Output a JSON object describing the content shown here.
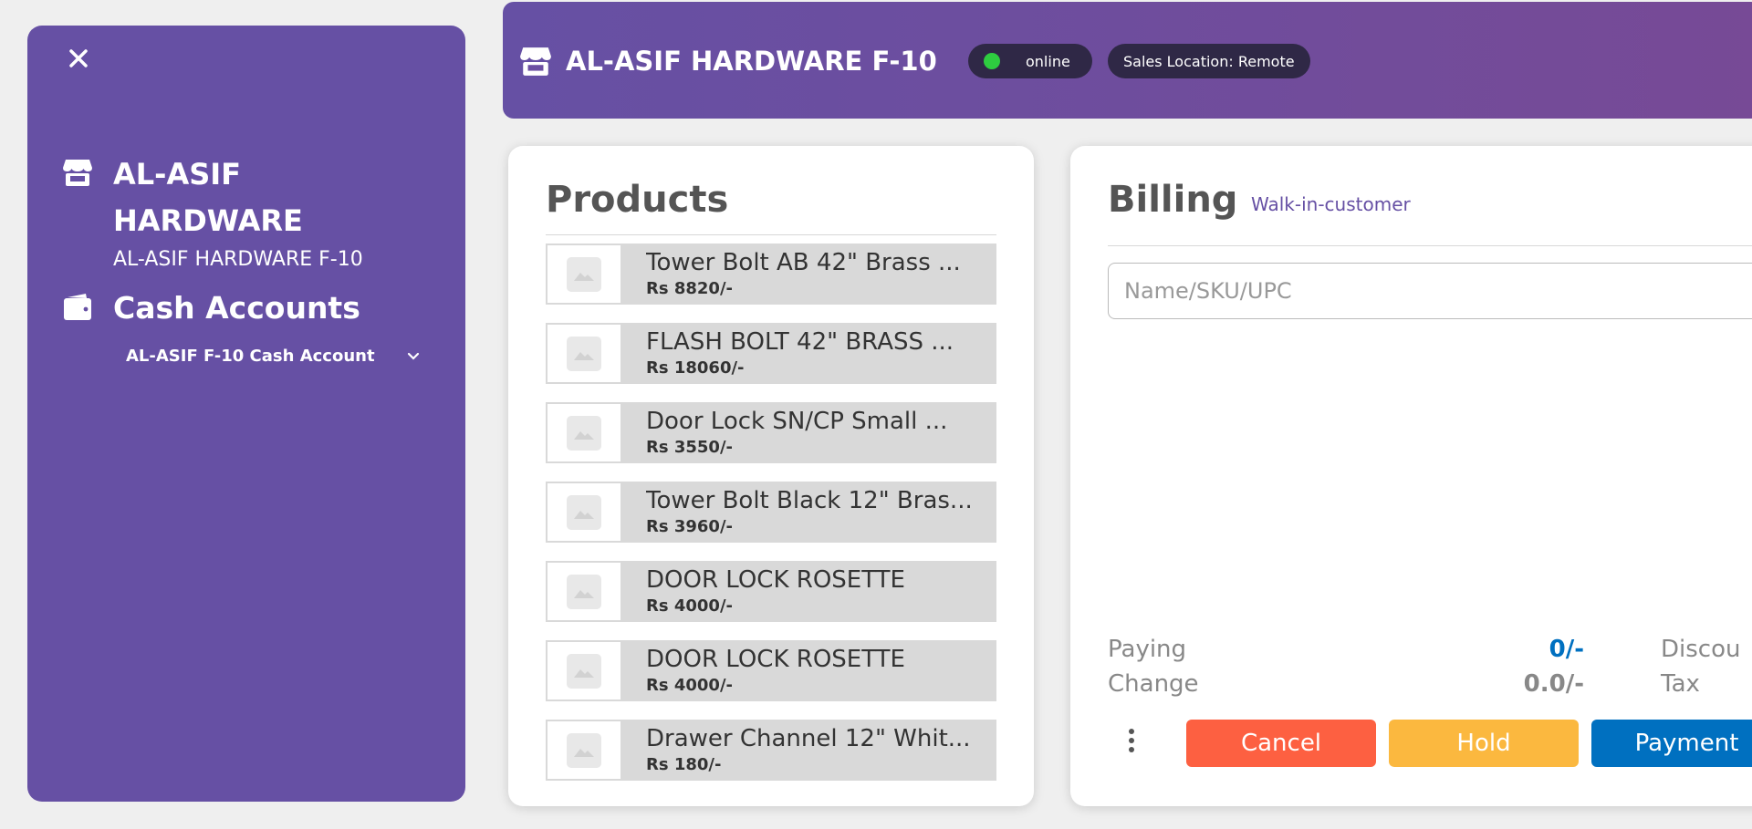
{
  "sidebar": {
    "store_name": "AL-ASIF HARDWARE",
    "store_subtitle": "AL-ASIF HARDWARE F-10",
    "cash_title": "Cash Accounts",
    "cash_account_selected": "AL-ASIF F-10 Cash Account"
  },
  "header": {
    "title": "AL-ASIF HARDWARE F-10",
    "status": "online",
    "status_color": "#2ecc40",
    "location": "Sales Location: Remote"
  },
  "products": {
    "title": "Products",
    "items": [
      {
        "name": "Tower Bolt AB 42\" Brass ...",
        "price": "Rs 8820/-"
      },
      {
        "name": "FLASH BOLT 42\" BRASS ...",
        "price": "Rs 18060/-"
      },
      {
        "name": "Door Lock SN/CP Small ...",
        "price": "Rs 3550/-"
      },
      {
        "name": "Tower Bolt Black 12\" Bras...",
        "price": "Rs 3960/-"
      },
      {
        "name": "DOOR LOCK ROSETTE",
        "price": "Rs 4000/-"
      },
      {
        "name": "DOOR LOCK ROSETTE",
        "price": "Rs 4000/-"
      },
      {
        "name": "Drawer Channel 12\" Whit...",
        "price": "Rs 180/-"
      }
    ]
  },
  "billing": {
    "title": "Billing",
    "customer": "Walk-in-customer",
    "search_placeholder": "Name/SKU/UPC",
    "paying_label": "Paying",
    "paying_value": "0/-",
    "change_label": "Change",
    "change_value": "0.0/-",
    "discount_label": "Discou",
    "tax_label": "Tax",
    "cancel_label": "Cancel",
    "hold_label": "Hold",
    "payment_label": "Payment"
  },
  "colors": {
    "brand": "#6650a4",
    "cancel": "#fd6041",
    "hold": "#fbb83f",
    "payment": "#0070c0",
    "paying_value": "#0070c0"
  }
}
